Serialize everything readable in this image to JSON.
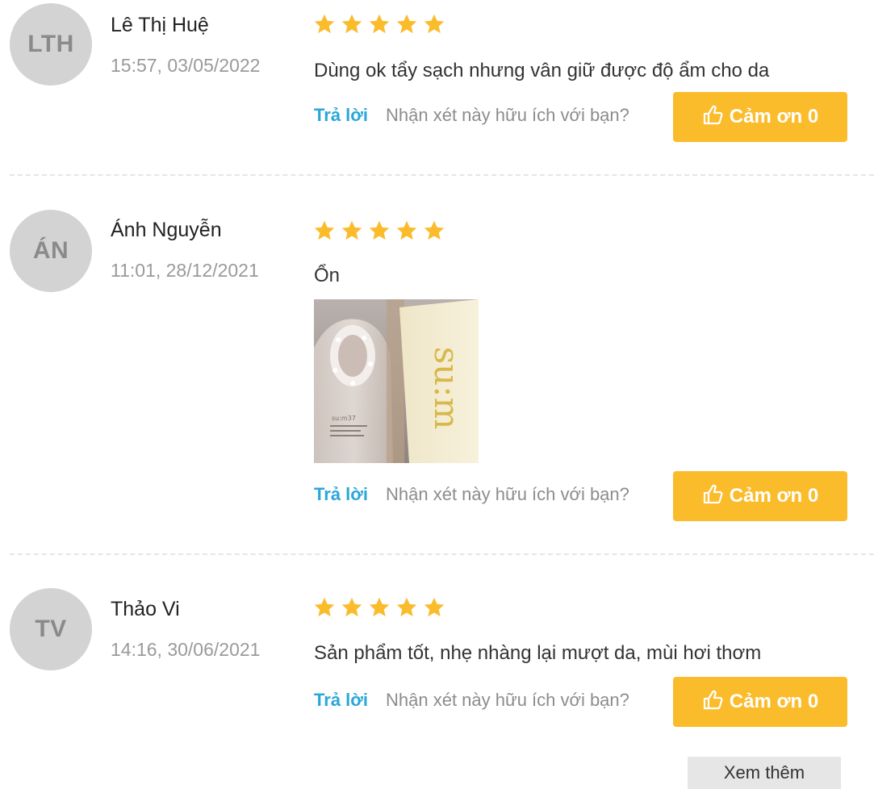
{
  "colors": {
    "star": "#fbbc2c",
    "thanks_button": "#fbbc2c",
    "reply_link": "#2aa7d8",
    "avatar_bg": "#d3d3d3"
  },
  "reviews": [
    {
      "initials": "LTH",
      "name": "Lê Thị Huệ",
      "date": "15:57, 03/05/2022",
      "rating": 5,
      "comment": "Dùng ok tẩy sạch nhưng vân giữ được độ ẩm cho da",
      "reply_label": "Trả lời",
      "helpful_text": "Nhận xét này hữu ích với bạn?",
      "thanks_label": "Cảm ơn 0"
    },
    {
      "initials": "ÁN",
      "name": "Ánh Nguyễn",
      "date": "11:01, 28/12/2021",
      "rating": 5,
      "comment": "Ổn",
      "photo_text": "su:m",
      "reply_label": "Trả lời",
      "helpful_text": "Nhận xét này hữu ích với bạn?",
      "thanks_label": "Cảm ơn 0"
    },
    {
      "initials": "TV",
      "name": "Thảo Vi",
      "date": "14:16, 30/06/2021",
      "rating": 5,
      "comment": "Sản phẩm tốt,  nhẹ nhàng lại mượt da, mùi hơi thơm",
      "reply_label": "Trả lời",
      "helpful_text": "Nhận xét này hữu ích với bạn?",
      "thanks_label": "Cảm ơn 0"
    }
  ],
  "see_more_label": "Xem thêm"
}
